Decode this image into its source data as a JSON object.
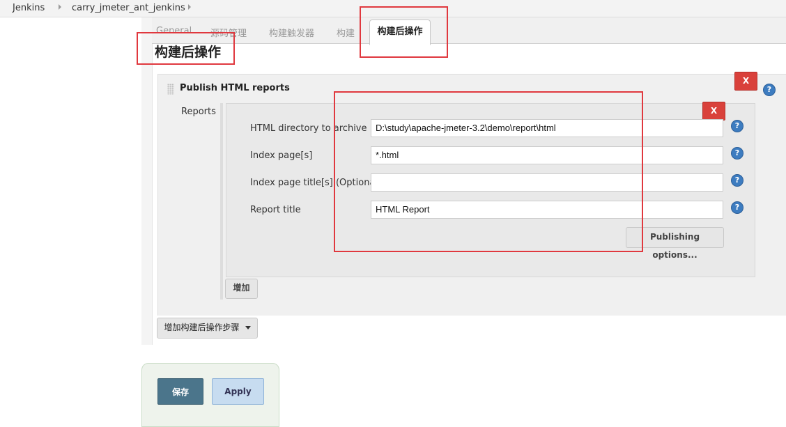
{
  "breadcrumb": [
    "Jenkins",
    "carry_jmeter_ant_jenkins"
  ],
  "tabs": [
    "General",
    "源码管理",
    "构建触发器",
    "构建",
    "构建后操作"
  ],
  "section_title": "构建后操作",
  "publish": {
    "title": "Publish HTML reports",
    "reports_label": "Reports",
    "delete_label": "X",
    "fields": [
      {
        "label": "HTML directory to archive",
        "value": "D:\\study\\apache-jmeter-3.2\\demo\\report\\html"
      },
      {
        "label": "Index page[s]",
        "value": "*.html"
      },
      {
        "label": "Index page title[s] (Optional)",
        "value": ""
      },
      {
        "label": "Report title",
        "value": "HTML Report"
      }
    ],
    "publishing_options": "Publishing options...",
    "add_label": "增加"
  },
  "add_post_build_step": "增加构建后操作步骤",
  "help_glyph": "?",
  "footer": {
    "save": "保存",
    "apply": "Apply"
  },
  "colors": {
    "annotation": "#e0383e",
    "delete": "#d9413b",
    "help": "#3d7cc0",
    "save": "#4b758b",
    "apply": "#c7dcf0"
  }
}
